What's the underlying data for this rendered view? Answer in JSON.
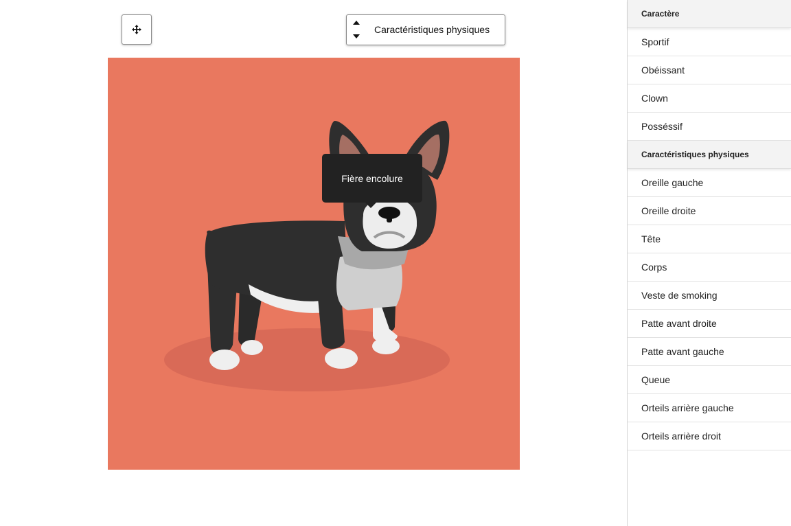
{
  "toolbar": {
    "move_icon": "move-arrows-icon",
    "group_select_value": "Caractéristiques physiques"
  },
  "tooltip": {
    "text": "Fière encolure"
  },
  "colors": {
    "canvas_background": "#e9785f",
    "tooltip_background": "#222222"
  },
  "sidebar": {
    "groups": [
      {
        "title": "Caractère",
        "items": [
          "Sportif",
          "Obéissant",
          "Clown",
          "Posséssif"
        ]
      },
      {
        "title": "Caractéristiques physiques",
        "items": [
          "Oreille gauche",
          "Oreille droite",
          "Tête",
          "Corps",
          "Veste de smoking",
          "Patte avant droite",
          "Patte avant gauche",
          "Queue",
          "Orteils arrière gauche",
          "Orteils arrière droit"
        ]
      }
    ]
  }
}
